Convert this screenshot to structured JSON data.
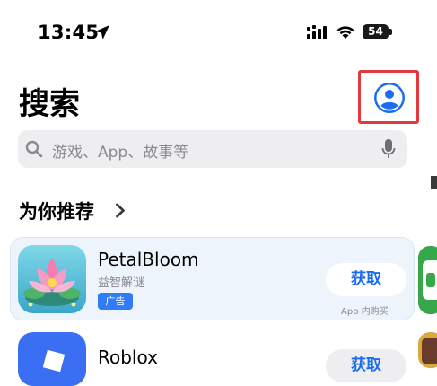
{
  "status_bar": {
    "time": "13:45",
    "battery_level": "54",
    "location_icon": "location-arrow-icon",
    "signal_icon": "cellular-signal-icon",
    "wifi_icon": "wifi-icon"
  },
  "header": {
    "title": "搜索",
    "account_icon": "person-circle-icon",
    "highlight_color": "#e0393e"
  },
  "search": {
    "placeholder": "游戏、App、故事等",
    "search_icon": "magnifier-icon",
    "mic_icon": "microphone-icon"
  },
  "recommendations": {
    "section_title": "为你推荐",
    "chevron_icon": "chevron-right-icon",
    "apps": [
      {
        "name": "PetalBloom",
        "subtitle": "益智解谜",
        "badge": "广告",
        "action": "获取",
        "note": "App 内购买",
        "icon": "lotus-flower-icon"
      },
      {
        "name": "Roblox",
        "action": "获取",
        "icon": "roblox-tile-icon"
      }
    ]
  },
  "colors": {
    "accent": "#1a6df0",
    "ad_badge": "#2f7cf6",
    "card_background": "#eef4fc"
  }
}
